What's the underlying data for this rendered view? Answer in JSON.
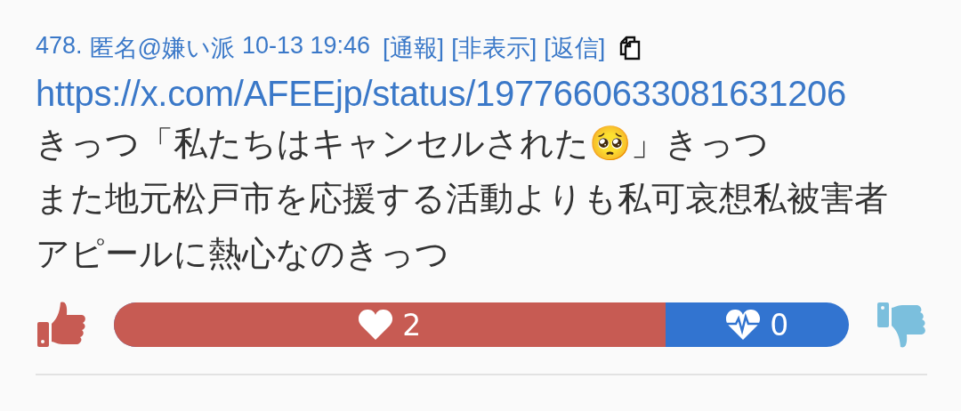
{
  "post": {
    "number": "478.",
    "author": "匿名@嫌い派",
    "date": "10-13 19:46",
    "actions": [
      {
        "label": "[通報]"
      },
      {
        "label": "[非表示]"
      },
      {
        "label": "[返信]"
      }
    ],
    "link": "https://x.com/AFEEjp/status/1977660633081631206",
    "lines": [
      "きっつ「私たちはキャンセルされた🥺」きっつ",
      "また地元松戸市を応援する活動よりも私可哀想私被害者",
      "アピールに熱心なのきっつ"
    ],
    "votes": {
      "like_count": "2",
      "dislike_count": "0",
      "level": 0.75
    }
  }
}
